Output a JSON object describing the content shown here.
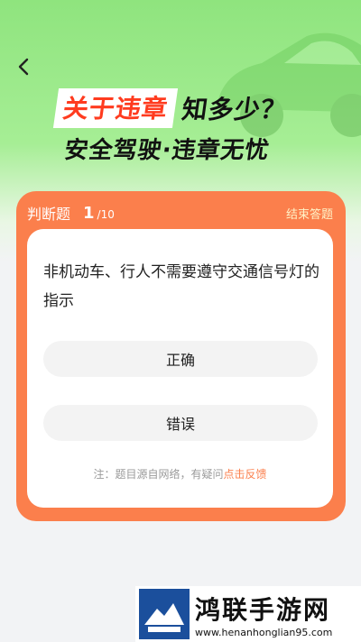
{
  "header": {
    "back_icon": "chevron-left-icon",
    "headline_highlight": "关于违章",
    "headline_rest": "知多少？",
    "subheadline": "安全驾驶·违章无忧"
  },
  "quiz": {
    "type_label": "判断题",
    "current": "1",
    "total": "/10",
    "end_label": "结束答题",
    "question": "非机动车、行人不需要遵守交通信号灯的指示",
    "options": [
      "正确",
      "错误"
    ],
    "note_prefix": "注：题目源自网络，有疑问",
    "note_link": "点击反馈"
  },
  "watermark": {
    "title": "鸿联手游网",
    "url": "www.henanhonglian95.com"
  },
  "colors": {
    "hero_green": "#8fe47e",
    "card_orange": "#fb7f4c",
    "headline_red": "#ff3b1f"
  }
}
